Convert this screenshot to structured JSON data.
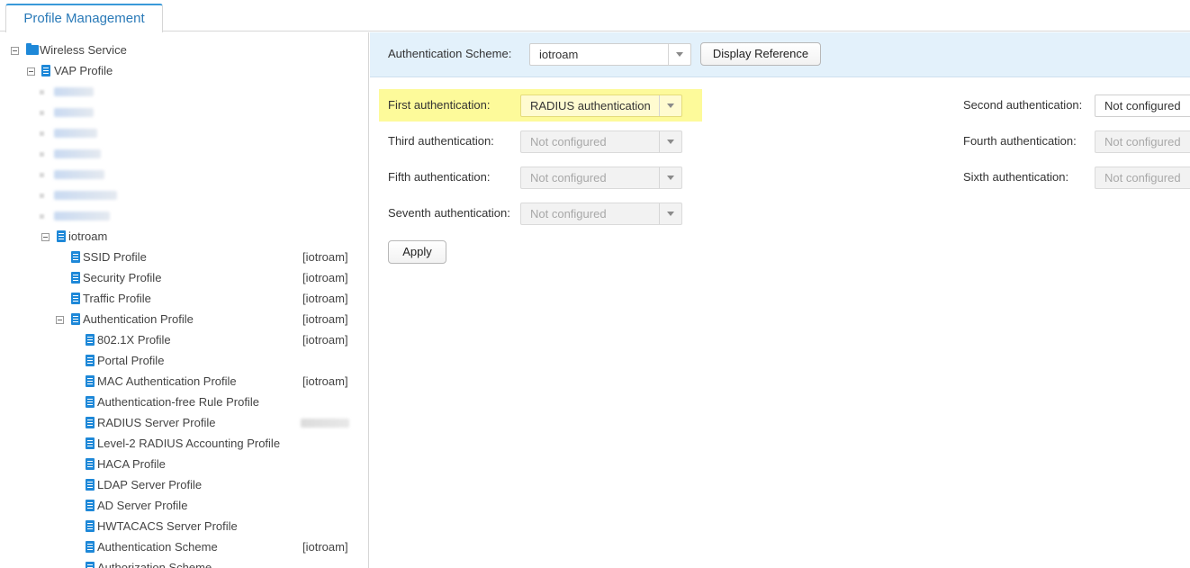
{
  "tabs": [
    {
      "label": "Profile Management"
    }
  ],
  "tree": {
    "root": "Wireless Service",
    "vap_profile": "VAP Profile",
    "iotroam": "iotroam",
    "children": [
      {
        "label": "SSID Profile",
        "tag": "[iotroam]"
      },
      {
        "label": "Security Profile",
        "tag": "[iotroam]"
      },
      {
        "label": "Traffic Profile",
        "tag": "[iotroam]"
      },
      {
        "label": "Authentication Profile",
        "tag": "[iotroam]"
      }
    ],
    "auth_children": [
      {
        "label": "802.1X Profile",
        "tag": "[iotroam]"
      },
      {
        "label": "Portal Profile",
        "tag": ""
      },
      {
        "label": "MAC Authentication Profile",
        "tag": "[iotroam]"
      },
      {
        "label": "Authentication-free Rule Profile",
        "tag": ""
      },
      {
        "label": "RADIUS Server Profile",
        "tag": ""
      },
      {
        "label": "Level-2 RADIUS Accounting Profile",
        "tag": ""
      },
      {
        "label": "HACA Profile",
        "tag": ""
      },
      {
        "label": "LDAP Server Profile",
        "tag": ""
      },
      {
        "label": "AD Server Profile",
        "tag": ""
      },
      {
        "label": "HWTACACS Server Profile",
        "tag": ""
      },
      {
        "label": "Authentication Scheme",
        "tag": "[iotroam]"
      },
      {
        "label": "Authorization Scheme",
        "tag": ""
      }
    ]
  },
  "form": {
    "scheme_label": "Authentication Scheme:",
    "scheme_value": "iotroam",
    "display_reference": "Display Reference",
    "first_label": "First authentication:",
    "first_value": "RADIUS authentication",
    "second_label": "Second authentication:",
    "second_value": "Not configured",
    "third_label": "Third authentication:",
    "third_value": "Not configured",
    "fourth_label": "Fourth authentication:",
    "fourth_value": "Not configured",
    "fifth_label": "Fifth authentication:",
    "fifth_value": "Not configured",
    "sixth_label": "Sixth authentication:",
    "sixth_value": "Not configured",
    "seventh_label": "Seventh authentication:",
    "seventh_value": "Not configured",
    "apply": "Apply"
  },
  "colors": {
    "accent": "#2a7ab8",
    "icon_blue": "#1e88d8",
    "highlight": "#fdfa9a",
    "header_bg": "#e3f1fb"
  }
}
